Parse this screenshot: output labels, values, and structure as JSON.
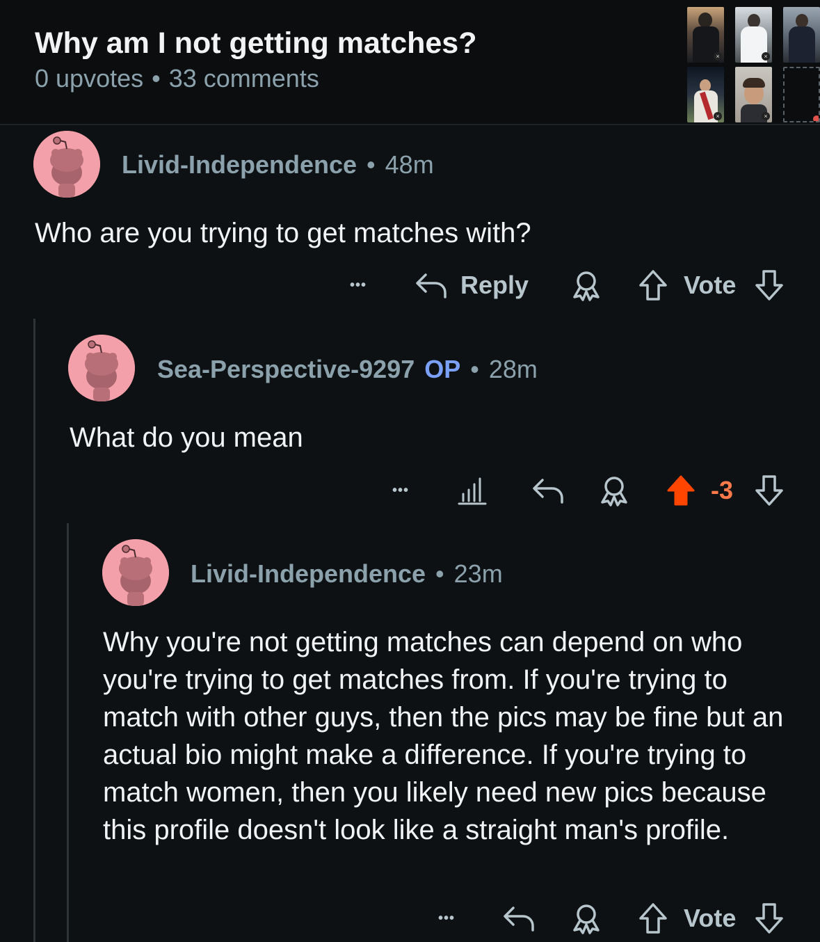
{
  "post": {
    "title": "Why am I not getting matches?",
    "upvotes": "0 upvotes",
    "separator": "•",
    "comments": "33 comments"
  },
  "comments": [
    {
      "username": "Livid-Independence",
      "op_badge": "",
      "separator": "•",
      "time": "48m",
      "text": "Who are you trying to get matches with?",
      "more": "•••",
      "reply": "Reply",
      "vote": "Vote"
    },
    {
      "username": "Sea-Perspective-9297",
      "op_badge": "OP",
      "separator": "•",
      "time": "28m",
      "text": "What do you mean",
      "more": "•••",
      "score": "-3",
      "upvote_color": "#ff4500",
      "score_color": "#ff7a4a"
    },
    {
      "username": "Livid-Independence",
      "op_badge": "",
      "separator": "•",
      "time": "23m",
      "text": "Why you're not getting matches can depend on who you're trying to get matches from. If you're trying to match with other guys, then the pics may be fine but an actual bio might make a difference. If you're trying to match women, then you likely need new pics because this profile doesn't look like a straight man's profile.",
      "more": "•••",
      "vote": "Vote"
    }
  ],
  "icons": {
    "more": "more-icon",
    "reply": "reply-arrow-icon",
    "award": "award-icon",
    "upvote": "upvote-arrow-icon",
    "downvote": "downvote-arrow-icon",
    "insights": "bar-chart-icon",
    "avatar": "snoo-avatar-icon"
  },
  "colors": {
    "background": "#0e1113",
    "muted": "#8ba2ad",
    "op": "#7aa1f7",
    "avatar_bg": "#f3a0aa"
  }
}
